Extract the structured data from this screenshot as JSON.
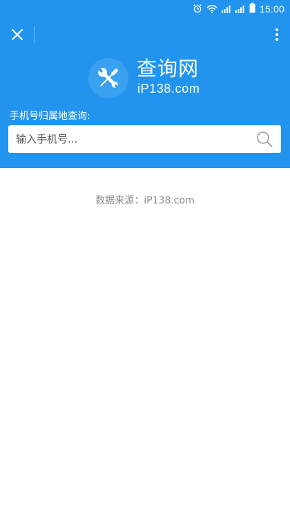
{
  "status_bar": {
    "time": "15:00",
    "icons": [
      "alarm-icon",
      "wifi-icon",
      "signal-icon",
      "signal-icon",
      "battery-icon"
    ]
  },
  "header": {
    "close_icon": "close-icon",
    "more_icon": "more-vertical-icon",
    "logo_icon": "tools-wrench-screwdriver-icon",
    "logo_title": "查询网",
    "logo_subtitle": "iP138.com",
    "query_label": "手机号归属地查询:",
    "search": {
      "placeholder": "输入手机号...",
      "value": ""
    }
  },
  "main": {
    "source_text": "数据来源：iP138.com"
  },
  "colors": {
    "header_bg": "#2394ed",
    "logo_circle": "#3aa0f0",
    "source_text": "#8a8a8a"
  }
}
